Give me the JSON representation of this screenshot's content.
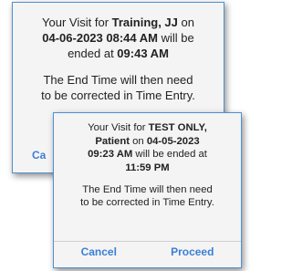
{
  "back_dialog": {
    "line1_prefix": "Your Visit for ",
    "line1_name": "Training, JJ",
    "line1_on": " on",
    "line2_datetime": "04-06-2023 08:44 AM",
    "line2_suffix": " will be",
    "line3_prefix": "ended at ",
    "line3_time": "09:43 AM",
    "note_line1": "The End Time will then need",
    "note_line2": "to be corrected in Time Entry.",
    "cancel_label": "Ca"
  },
  "front_dialog": {
    "line1_prefix": "Your Visit for ",
    "line1_name": "TEST ONLY,",
    "line2_name": "Patient",
    "line2_on": " on ",
    "line2_date": "04-05-2023",
    "line3_time": "09:23 AM",
    "line3_suffix": " will be ended at",
    "line4_time": "11:59 PM",
    "note_line1": "The End Time will then need",
    "note_line2": "to be corrected in Time Entry.",
    "cancel_label": "Cancel",
    "proceed_label": "Proceed"
  },
  "colors": {
    "accent": "#3b7fd6",
    "border": "#4f8fd1",
    "dialog_bg": "#f4f4f4"
  }
}
